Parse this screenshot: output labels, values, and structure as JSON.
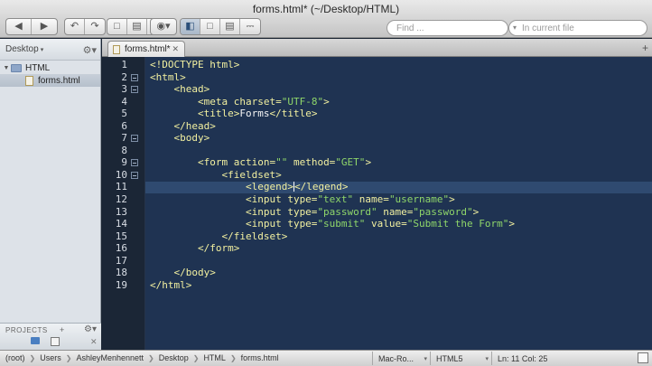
{
  "window": {
    "title": "forms.html* (~/Desktop/HTML)"
  },
  "toolbar": {
    "icons": [
      "back-icon",
      "forward-icon",
      "undo-icon",
      "redo-icon",
      "new-file-icon",
      "open-folder-icon",
      "save-icon",
      "globe-icon",
      "layout-sidebar-icon",
      "layout-single-icon",
      "layout-split-icon",
      "print-icon"
    ]
  },
  "search": {
    "find_placeholder": "Find ...",
    "scope_placeholder": "In current file"
  },
  "sidebar": {
    "location_label": "Desktop",
    "tree": [
      {
        "label": "HTML",
        "type": "folder"
      },
      {
        "label": "forms.html",
        "type": "file"
      }
    ],
    "projects_label": "PROJECTS"
  },
  "tabs": [
    {
      "label": "forms.html*"
    }
  ],
  "editor": {
    "lines": [
      {
        "n": "1",
        "text": "<!DOCTYPE html>"
      },
      {
        "n": "2",
        "text": "<html>"
      },
      {
        "n": "3",
        "text": "    <head>"
      },
      {
        "n": "4",
        "pre": "        <meta charset=",
        "str": "\"UTF-8\"",
        "post": ">"
      },
      {
        "n": "5",
        "pre": "        <title>",
        "plain": "Forms",
        "post": "</title>"
      },
      {
        "n": "6",
        "text": "    </head>"
      },
      {
        "n": "7",
        "text": "    <body>"
      },
      {
        "n": "8",
        "text": ""
      },
      {
        "n": "9",
        "pre": "        <form action=",
        "str": "\"\"",
        "mid": " method=",
        "str2": "\"GET\"",
        "post": ">"
      },
      {
        "n": "10",
        "text": "            <fieldset>"
      },
      {
        "n": "11",
        "pre": "                <legend>",
        "caret": true,
        "post": "</legend>"
      },
      {
        "n": "12",
        "pre": "                <input type=",
        "str": "\"text\"",
        "mid": " name=",
        "str2": "\"username\"",
        "post": ">"
      },
      {
        "n": "13",
        "pre": "                <input type=",
        "str": "\"password\"",
        "mid": " name=",
        "str2": "\"password\"",
        "post": ">"
      },
      {
        "n": "14",
        "pre": "                <input type=",
        "str": "\"submit\"",
        "mid": " value=",
        "str2": "\"Submit the Form\"",
        "post": ">"
      },
      {
        "n": "15",
        "text": "            </fieldset>"
      },
      {
        "n": "16",
        "text": "        </form>"
      },
      {
        "n": "17",
        "text": ""
      },
      {
        "n": "18",
        "text": "    </body>"
      },
      {
        "n": "19",
        "text": "</html>"
      }
    ],
    "fold_lines": [
      "2",
      "3",
      "7",
      "9",
      "10"
    ],
    "current_line": "11"
  },
  "statusbar": {
    "breadcrumbs": [
      "(root)",
      "Users",
      "AshleyMenhennett",
      "Desktop",
      "HTML",
      "forms.html"
    ],
    "encoding": "Mac-Ro...",
    "syntax": "HTML5",
    "position": "Ln: 11 Col: 25"
  },
  "colors": {
    "editor_bg": "#1f3352",
    "gutter_bg": "#1b2636",
    "current_line": "#2f4a70",
    "tag": "#f2f0a0",
    "string": "#8fd66a"
  }
}
